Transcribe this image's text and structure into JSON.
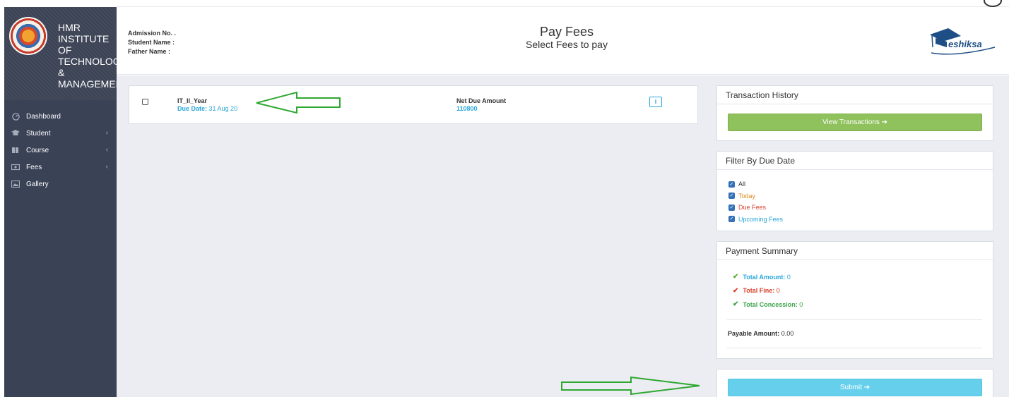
{
  "sidebar": {
    "brand_lines": [
      "HMR",
      "INSTITUTE",
      "OF",
      "TECHNOLOGY",
      "&",
      "MANAGEMENT"
    ],
    "items": [
      {
        "label": "Dashboard",
        "icon": "dashboard-icon",
        "has_submenu": false
      },
      {
        "label": "Student",
        "icon": "student-icon",
        "has_submenu": true
      },
      {
        "label": "Course",
        "icon": "course-icon",
        "has_submenu": true
      },
      {
        "label": "Fees",
        "icon": "fees-icon",
        "has_submenu": true
      },
      {
        "label": "Gallery",
        "icon": "gallery-icon",
        "has_submenu": false
      }
    ],
    "chevron": "‹"
  },
  "header": {
    "admission_no_label": "Admission No. .",
    "student_name_label": "Student Name :",
    "father_name_label": "Father Name :",
    "title": "Pay Fees",
    "subtitle": "Select Fees to pay",
    "logo_text": "eshiksa"
  },
  "fee": {
    "name": "IT_II_Year",
    "due_label": "Due Date:",
    "due_value": "31 Aug 20",
    "net_due_label": "Net Due Amount",
    "net_due_value": "110800",
    "info_label": "i"
  },
  "transaction_history": {
    "title": "Transaction History",
    "button_label": "View Transactions ➔"
  },
  "filter": {
    "title": "Filter By Due Date",
    "options": [
      {
        "label": "All",
        "color": "#333333",
        "checked": true
      },
      {
        "label": "Today",
        "color": "#e08a1e",
        "checked": true
      },
      {
        "label": "Due Fees",
        "color": "#d9402b",
        "checked": true
      },
      {
        "label": "Upcoming Fees",
        "color": "#29a6d9",
        "checked": true
      }
    ]
  },
  "summary": {
    "title": "Payment Summary",
    "total_amount_label": "Total Amount:",
    "total_amount_value": "0",
    "total_fine_label": "Total Fine:",
    "total_fine_value": "0",
    "total_concession_label": "Total Concession:",
    "total_concession_value": "0",
    "payable_label": "Payable Amount:",
    "payable_value": "0.00"
  },
  "submit": {
    "button_label": "Submit ➔"
  },
  "colors": {
    "sidebar_bg": "#3a4256",
    "accent_blue": "#29a6d9",
    "green_button": "#8fc15c",
    "submit_button": "#66d0ec",
    "arrow_green": "#2fa832"
  }
}
